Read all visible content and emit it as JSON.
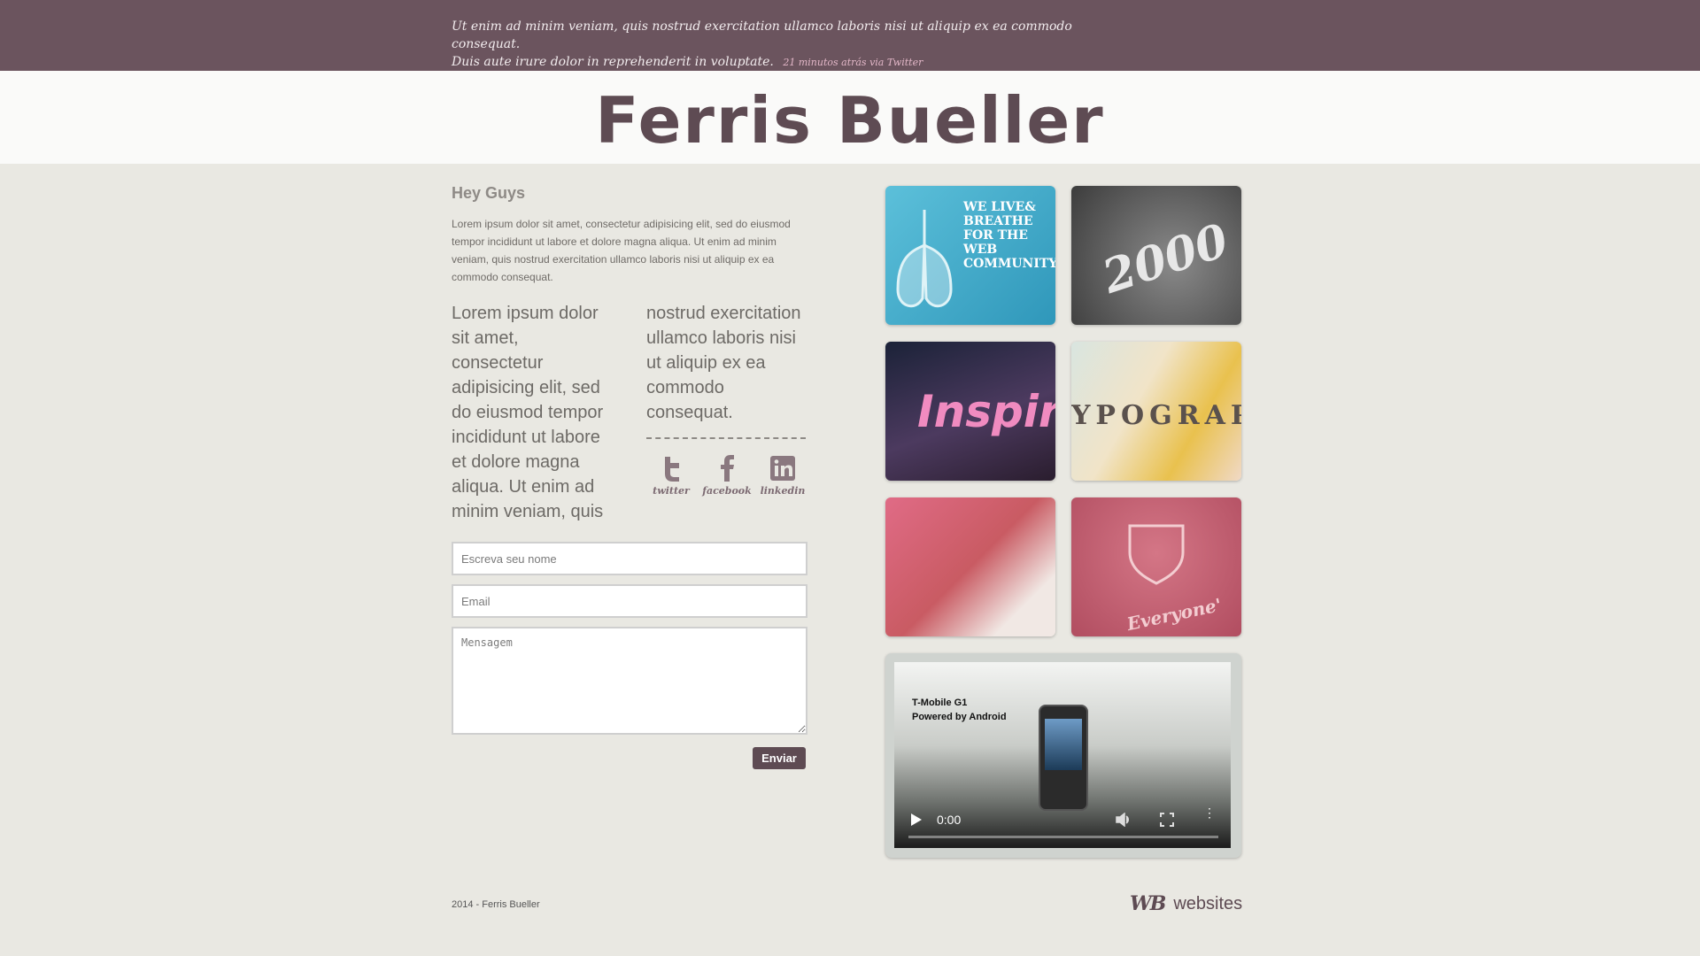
{
  "topbar": {
    "tweet_line1": "Ut enim ad minim veniam, quis nostrud exercitation ullamco laboris nisi ut aliquip ex ea commodo consequat.",
    "tweet_line2": "Duis aute irure dolor in reprehenderit in voluptate.",
    "tweet_meta": "21 minutos atrás via Twitter"
  },
  "header": {
    "title": "Ferris Bueller"
  },
  "main": {
    "heading": "Hey Guys",
    "intro": "Lorem ipsum dolor sit amet, consectetur adipisicing elit, sed do eiusmod tempor incididunt ut labore et dolore magna aliqua. Ut enim ad minim veniam, quis nostrud exercitation ullamco laboris nisi ut aliquip ex ea commodo consequat.",
    "col1": "Lorem ipsum dolor sit amet, consectetur adipisicing elit, sed do eiusmod tempor incididunt ut labore et dolore magna aliqua. Ut enim ad minim veniam, quis",
    "col2": "nostrud exercitation ullamco laboris nisi ut aliquip ex ea commodo consequat."
  },
  "social": [
    {
      "label": "twitter",
      "icon": "twitter-icon"
    },
    {
      "label": "facebook",
      "icon": "facebook-icon"
    },
    {
      "label": "linkedin",
      "icon": "linkedin-icon"
    }
  ],
  "form": {
    "name_placeholder": "Escreva seu nome",
    "email_placeholder": "Email",
    "message_placeholder": "Mensagem",
    "submit_label": "Enviar"
  },
  "gallery": [
    {
      "text": "WE LIVE& BREATHE FOR THE WEB COMMUNITY",
      "color": "#4aaecb"
    },
    {
      "text": "2000",
      "color": "#585757"
    },
    {
      "text": "Inspir",
      "color": "#3d2f45"
    },
    {
      "text": "YPOGRAP",
      "color": "#efe7d6"
    },
    {
      "text": "",
      "color": "#d77d8d"
    },
    {
      "text": "Everyone'",
      "color": "#c55c6f"
    }
  ],
  "video": {
    "caption_line1": "T-Mobile G1",
    "caption_line2": "Powered by Android",
    "time": "0:00"
  },
  "footer": {
    "copyright": "2014 - Ferris Bueller",
    "logo_mark": "WB",
    "logo_word": "websites"
  },
  "colors": {
    "brand": "#5e4b53",
    "topbar": "#6b545e",
    "background": "#e9e8e2"
  }
}
